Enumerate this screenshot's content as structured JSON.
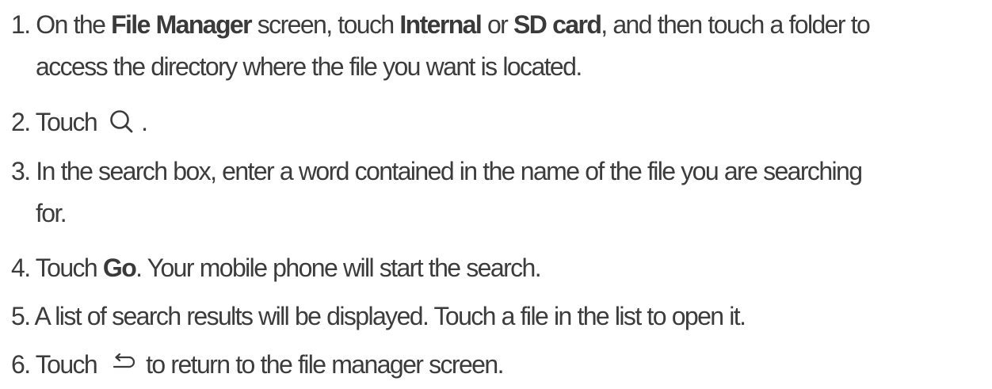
{
  "steps": [
    {
      "number": "1.",
      "t1": "On the",
      "b1": "File Manager",
      "t2": "screen, touch",
      "b2": "Internal",
      "t3": "or",
      "b3": "SD card",
      "t4": ", and then touch a folder to",
      "line2": "access the directory where the file you want is located."
    },
    {
      "number": "2.",
      "t1": "Touch",
      "icon": "search-icon",
      "t2": "."
    },
    {
      "number": "3.",
      "t1": "In the search box, enter a word contained in the name of the file you are searching",
      "line2": "for."
    },
    {
      "number": "4.",
      "t1": "Touch",
      "b1": "Go",
      "t2": ". Your mobile phone will start the search."
    },
    {
      "number": "5.",
      "t1": "A list of search results will be displayed. Touch a file in the list to open it."
    },
    {
      "number": "6.",
      "t1": "Touch",
      "icon": "back-icon",
      "t2": "to return to the file manager screen."
    }
  ]
}
